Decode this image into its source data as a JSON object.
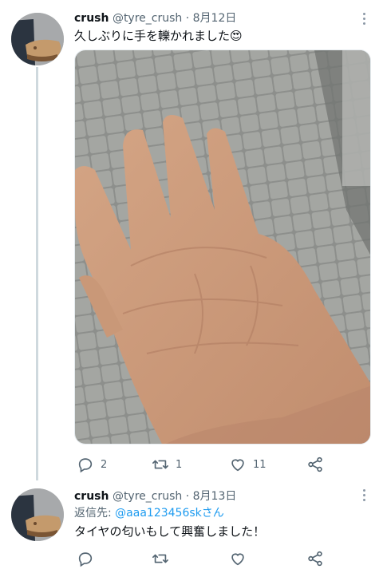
{
  "tweets": [
    {
      "display_name": "crush",
      "handle": "@tyre_crush",
      "separator": "·",
      "date": "8月12日",
      "text": "久しぶりに手を轢かれました😍",
      "media_description": "photo",
      "actions": {
        "replies": "2",
        "retweets": "1",
        "likes": "11"
      }
    },
    {
      "display_name": "crush",
      "handle": "@tyre_crush",
      "separator": "·",
      "date": "8月13日",
      "reply_prefix": "返信先: ",
      "reply_handle": "@aaa123456skさん",
      "text": "タイヤの匂いもして興奮しました！",
      "actions": {
        "replies": "",
        "retweets": "",
        "likes": ""
      }
    }
  ],
  "icons": {
    "reply": "speech-bubble-icon",
    "retweet": "retweet-icon",
    "like": "heart-icon",
    "share": "share-icon",
    "more": "more-vertical-icon"
  },
  "colors": {
    "accent_link": "#1d9bf0",
    "text_secondary": "#536471",
    "thread_line": "#cfd9de"
  }
}
